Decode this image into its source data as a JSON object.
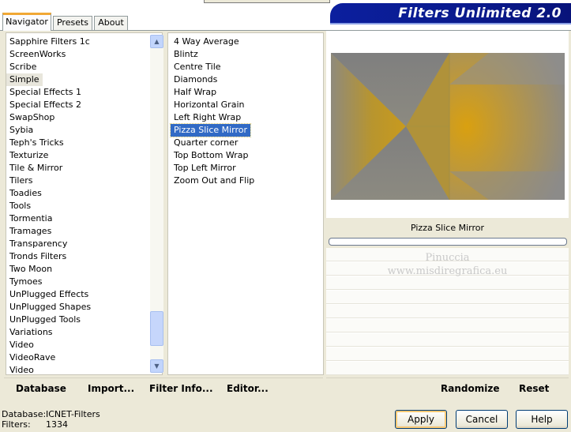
{
  "tabs": [
    {
      "label": "Navigator",
      "active": true
    },
    {
      "label": "Presets",
      "active": false
    },
    {
      "label": "About",
      "active": false
    }
  ],
  "banner": {
    "title": "Filters Unlimited 2.0"
  },
  "categories": {
    "items": [
      "Sapphire Filters 1c",
      "ScreenWorks",
      "Scribe",
      "Simple",
      "Special Effects 1",
      "Special Effects 2",
      "SwapShop",
      "Sybia",
      "Teph's Tricks",
      "Texturize",
      "Tile & Mirror",
      "Tilers",
      "Toadies",
      "Tools",
      "Tormentia",
      "Tramages",
      "Transparency",
      "Tronds Filters",
      "Two Moon",
      "Tymoes",
      "UnPlugged Effects",
      "UnPlugged Shapes",
      "UnPlugged Tools",
      "Variations",
      "Video",
      "VideoRave",
      "Video"
    ],
    "selected": "Simple"
  },
  "filters": {
    "items": [
      "4 Way Average",
      "Blintz",
      "Centre Tile",
      "Diamonds",
      "Half Wrap",
      "Horizontal Grain",
      "Left Right Wrap",
      "Pizza Slice Mirror",
      "Quarter corner",
      "Top Bottom Wrap",
      "Top Left Mirror",
      "Zoom Out and Flip"
    ],
    "selected": "Pizza Slice Mirror"
  },
  "preview": {
    "filter_name": "Pizza Slice Mirror",
    "progress": 0,
    "watermark_line1": "Pinuccia",
    "watermark_line2": "www.misdiregrafica.eu"
  },
  "bottom_bar": {
    "database": "Database",
    "import": "Import...",
    "filter_info": "Filter Info...",
    "editor": "Editor...",
    "randomize": "Randomize",
    "reset": "Reset"
  },
  "footer": {
    "database_label": "Database:",
    "database_value": "ICNET-Filters",
    "filters_label": "Filters:",
    "filters_value": "1334",
    "apply": "Apply",
    "cancel": "Cancel",
    "help": "Help"
  },
  "colors": {
    "banner": "#0b1f9e",
    "selection": "#316ac5",
    "preview_gold": "#d8a010",
    "preview_grey": "#8c8c8c"
  }
}
